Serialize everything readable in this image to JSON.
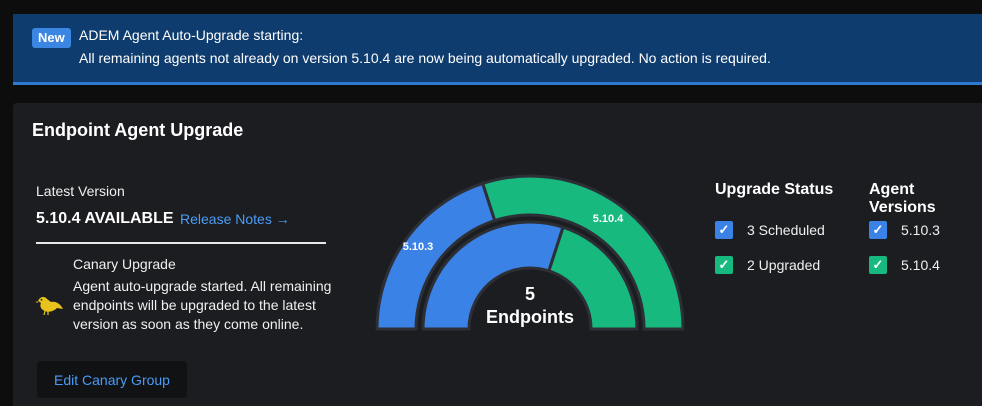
{
  "banner": {
    "badge": "New",
    "title": "ADEM Agent Auto-Upgrade starting:",
    "text": "All remaining agents not already on version 5.10.4 are now being automatically upgraded. No action is required."
  },
  "card": {
    "title": "Endpoint Agent Upgrade",
    "latest_version_label": "Latest Version",
    "latest_version_value": "5.10.4 AVAILABLE",
    "release_notes_link": "Release Notes →",
    "canary_title": "Canary Upgrade",
    "canary_text": "Agent auto-upgrade started. All remaining endpoints will be upgraded to the latest version as soon as they come online.",
    "edit_canary_button": "Edit Canary Group"
  },
  "gauge": {
    "center_count": "5",
    "center_label": "Endpoints",
    "outer_label_1": "5.10.3",
    "outer_label_2": "5.10.4",
    "outer_split_fraction": 0.4,
    "inner_split_fraction": 0.6
  },
  "upgrade_status": {
    "title": "Upgrade Status",
    "items": [
      {
        "label": "3 Scheduled",
        "color": "#3b82e6"
      },
      {
        "label": "2 Upgraded",
        "color": "#17b97f"
      }
    ]
  },
  "agent_versions": {
    "title": "Agent Versions",
    "items": [
      {
        "label": "5.10.3",
        "color": "#3b82e6"
      },
      {
        "label": "5.10.4",
        "color": "#17b97f"
      }
    ]
  },
  "colors": {
    "blue": "#3b82e6",
    "green": "#17b97f",
    "link": "#4a9cf7",
    "banner_bg": "#0f3c6e"
  }
}
